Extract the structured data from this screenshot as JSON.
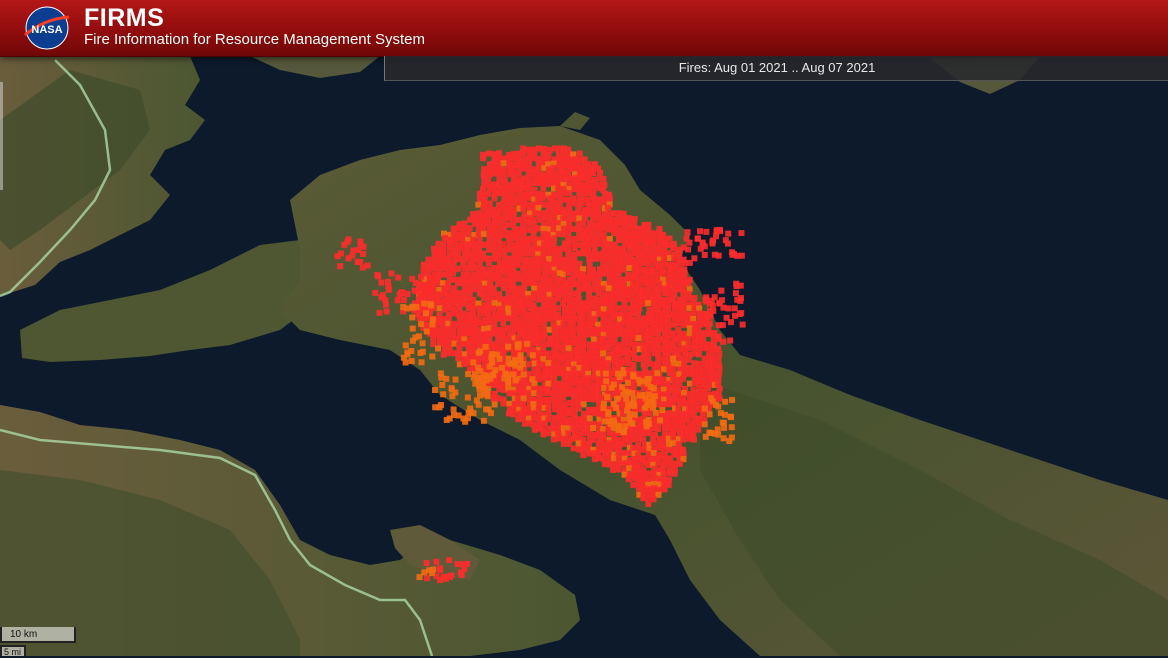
{
  "app": {
    "logo_text": "NASA",
    "title": "FIRMS",
    "subtitle": "Fire Information for Resource Management System"
  },
  "banner": {
    "date_range": "Fires: Aug 01 2021 .. Aug 07 2021"
  },
  "scale_bar": {
    "km_label": "10 km",
    "mi_label": "5 mi"
  },
  "colors": {
    "header_red": "#b41717",
    "fire_recent": "#ff2b2b",
    "fire_older": "#f46a12",
    "sea": "#0c1a2c",
    "land": "#4e5a34"
  },
  "icons": {
    "logo": "nasa-meatball-logo"
  }
}
